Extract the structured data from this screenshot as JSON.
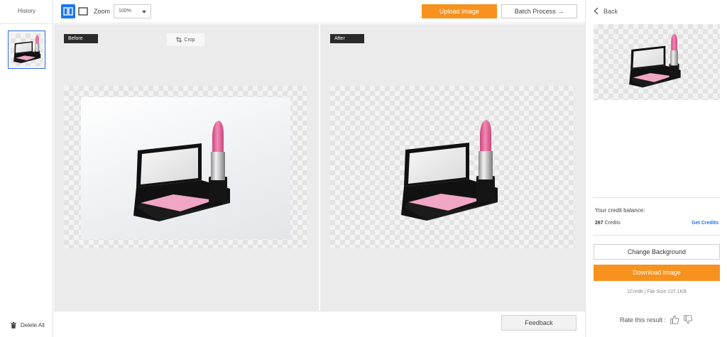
{
  "history": {
    "title": "History",
    "delete_all_label": "Delete All"
  },
  "toolbar": {
    "zoom_label": "Zoom",
    "zoom_value": "100%",
    "upload_label": "Upload Image",
    "batch_label": "Batch Process →"
  },
  "stage": {
    "before_tag": "Before",
    "after_tag": "After",
    "crop_label": "Crop"
  },
  "bottom": {
    "feedback_label": "Feedback"
  },
  "panel": {
    "back_label": "Back",
    "credit_balance_label": "Your credit balance:",
    "credits_amount": "267",
    "credits_word": "Credits",
    "get_credits_label": "Get Credits",
    "change_background_label": "Change Background",
    "download_label": "Download Image",
    "file_info": "1Credit | File Size:137.1KB",
    "rate_label": "Rate this result :"
  },
  "colors": {
    "accent_orange": "#f7921e",
    "accent_blue": "#1877f2",
    "link_blue": "#1a73e8",
    "lipstick_pink": "#e86a9e",
    "blush_pink": "#f0a6c4"
  },
  "icons": [
    "split-view-icon",
    "single-view-icon",
    "chevron-down-icon",
    "crop-icon",
    "trash-icon",
    "chevron-left-icon",
    "thumbs-up-icon",
    "thumbs-down-icon"
  ]
}
